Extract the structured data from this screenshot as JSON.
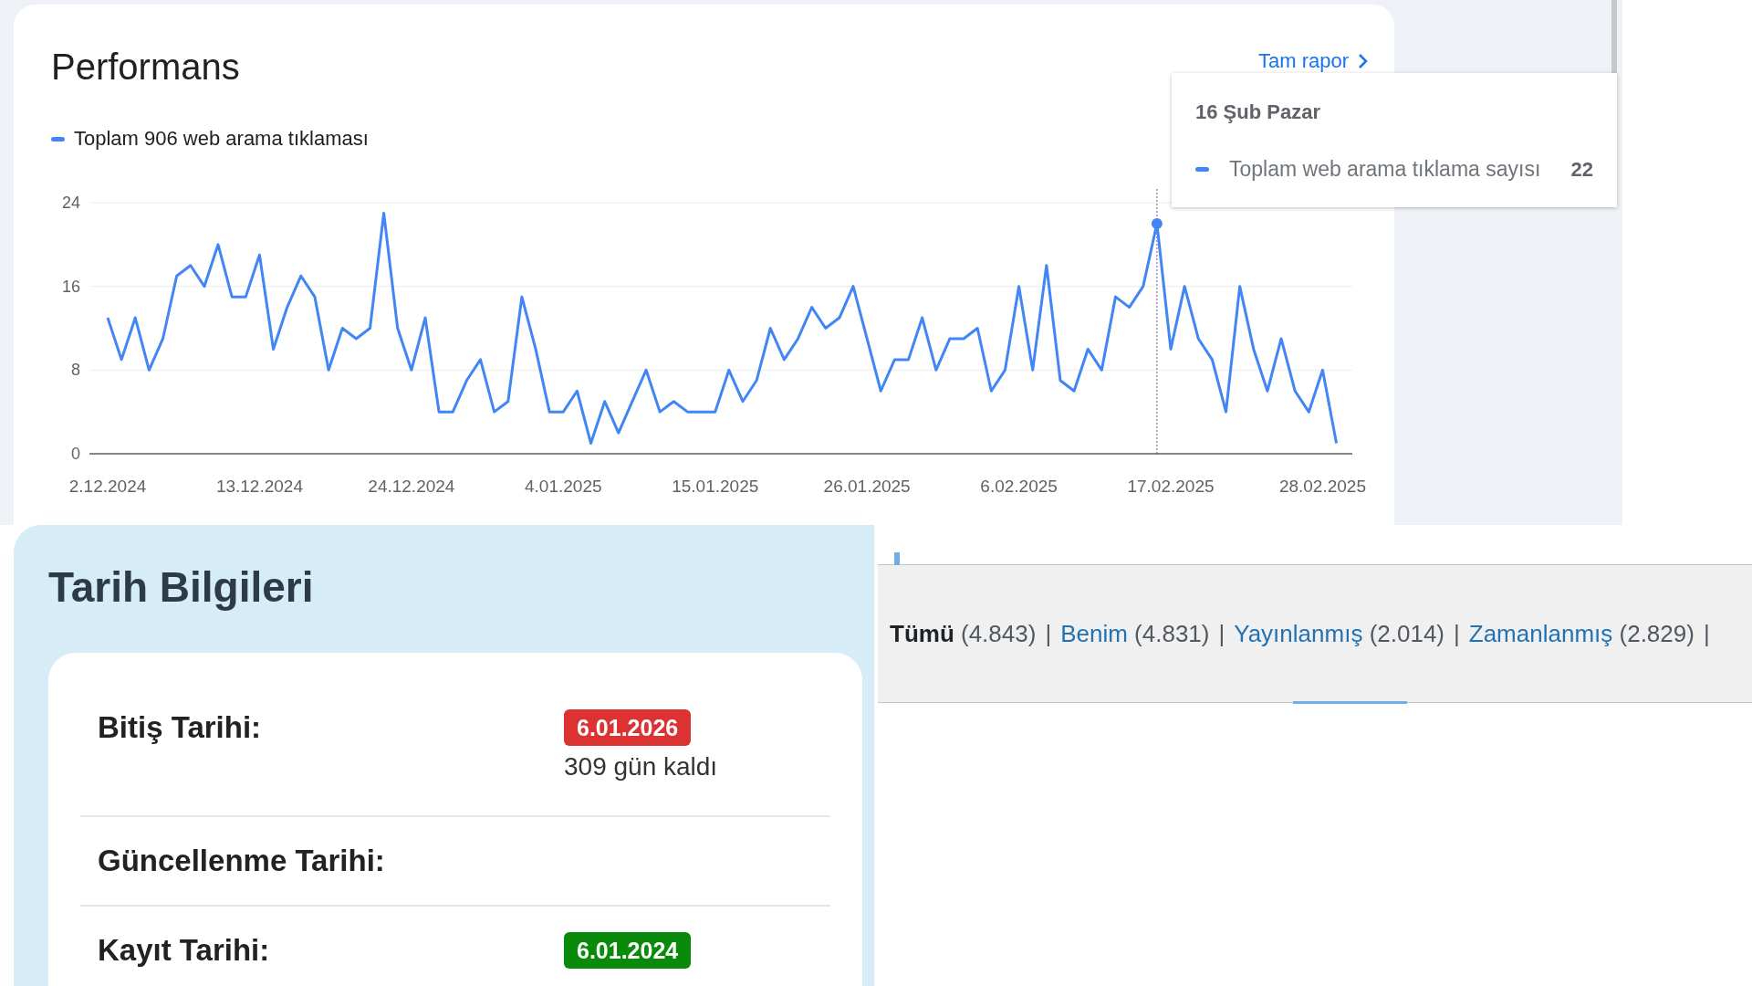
{
  "performance": {
    "title": "Performans",
    "full_report_link": "Tam rapor",
    "legend": "Toplam 906 web arama tıklaması",
    "chart_data": {
      "type": "line",
      "categories": [
        "2.12.2024",
        null,
        null,
        null,
        null,
        null,
        null,
        null,
        null,
        null,
        null,
        "13.12.2024",
        null,
        null,
        null,
        null,
        null,
        null,
        null,
        null,
        null,
        null,
        "24.12.2024",
        null,
        null,
        null,
        null,
        null,
        null,
        null,
        null,
        null,
        null,
        "4.01.2025",
        null,
        null,
        null,
        null,
        null,
        null,
        null,
        null,
        null,
        null,
        "15.01.2025",
        null,
        null,
        null,
        null,
        null,
        null,
        null,
        null,
        null,
        null,
        "26.01.2025",
        null,
        null,
        null,
        null,
        null,
        null,
        null,
        null,
        null,
        null,
        "6.02.2025",
        null,
        null,
        null,
        null,
        null,
        null,
        null,
        null,
        null,
        null,
        "17.02.2025",
        null,
        null,
        null,
        null,
        null,
        null,
        null,
        null,
        null,
        null,
        "28.02.2025",
        null
      ],
      "series": [
        {
          "name": "Toplam web arama tıklama sayısı",
          "color": "#4285f4",
          "values": [
            13,
            9,
            13,
            8,
            11,
            17,
            18,
            16,
            20,
            15,
            15,
            19,
            10,
            14,
            17,
            15,
            8,
            12,
            11,
            12,
            23,
            12,
            8,
            13,
            4,
            4,
            7,
            9,
            4,
            5,
            15,
            10,
            4,
            4,
            6,
            1,
            5,
            2,
            5,
            8,
            4,
            5,
            4,
            4,
            4,
            8,
            5,
            7,
            12,
            9,
            11,
            14,
            12,
            13,
            16,
            11,
            6,
            9,
            9,
            13,
            8,
            11,
            11,
            12,
            6,
            8,
            16,
            8,
            18,
            7,
            6,
            10,
            8,
            15,
            14,
            16,
            22,
            10,
            16,
            11,
            9,
            4,
            16,
            10,
            6,
            11,
            6,
            4,
            8,
            1
          ]
        }
      ],
      "ylim": [
        0,
        24
      ],
      "yticks": [
        0,
        8,
        16,
        24
      ]
    },
    "tooltip": {
      "date": "16 Şub Pazar",
      "value": "22"
    }
  },
  "date_info": {
    "title": "Tarih Bilgileri",
    "rows": [
      {
        "label": "Bitiş Tarihi:",
        "badge": "6.01.2026",
        "color": "#dc3232",
        "note": "309 gün kaldı"
      },
      {
        "label": "Güncellenme Tarihi:"
      },
      {
        "label": "Kayıt Tarihi:",
        "badge": "6.01.2024",
        "color": "#0a8a0a"
      }
    ]
  },
  "filter_links": [
    {
      "label": "Tümü",
      "count": "(4.843)",
      "selected": true,
      "separator": "|"
    },
    {
      "label": "Benim",
      "count": "(4.831)",
      "selected": false,
      "separator": "|"
    },
    {
      "label": "Yayınlanmış",
      "count": "(2.014)",
      "selected": false,
      "separator": "|"
    },
    {
      "label": "Zamanlanmış",
      "count": "(2.829)",
      "selected": false,
      "separator": "|"
    }
  ]
}
